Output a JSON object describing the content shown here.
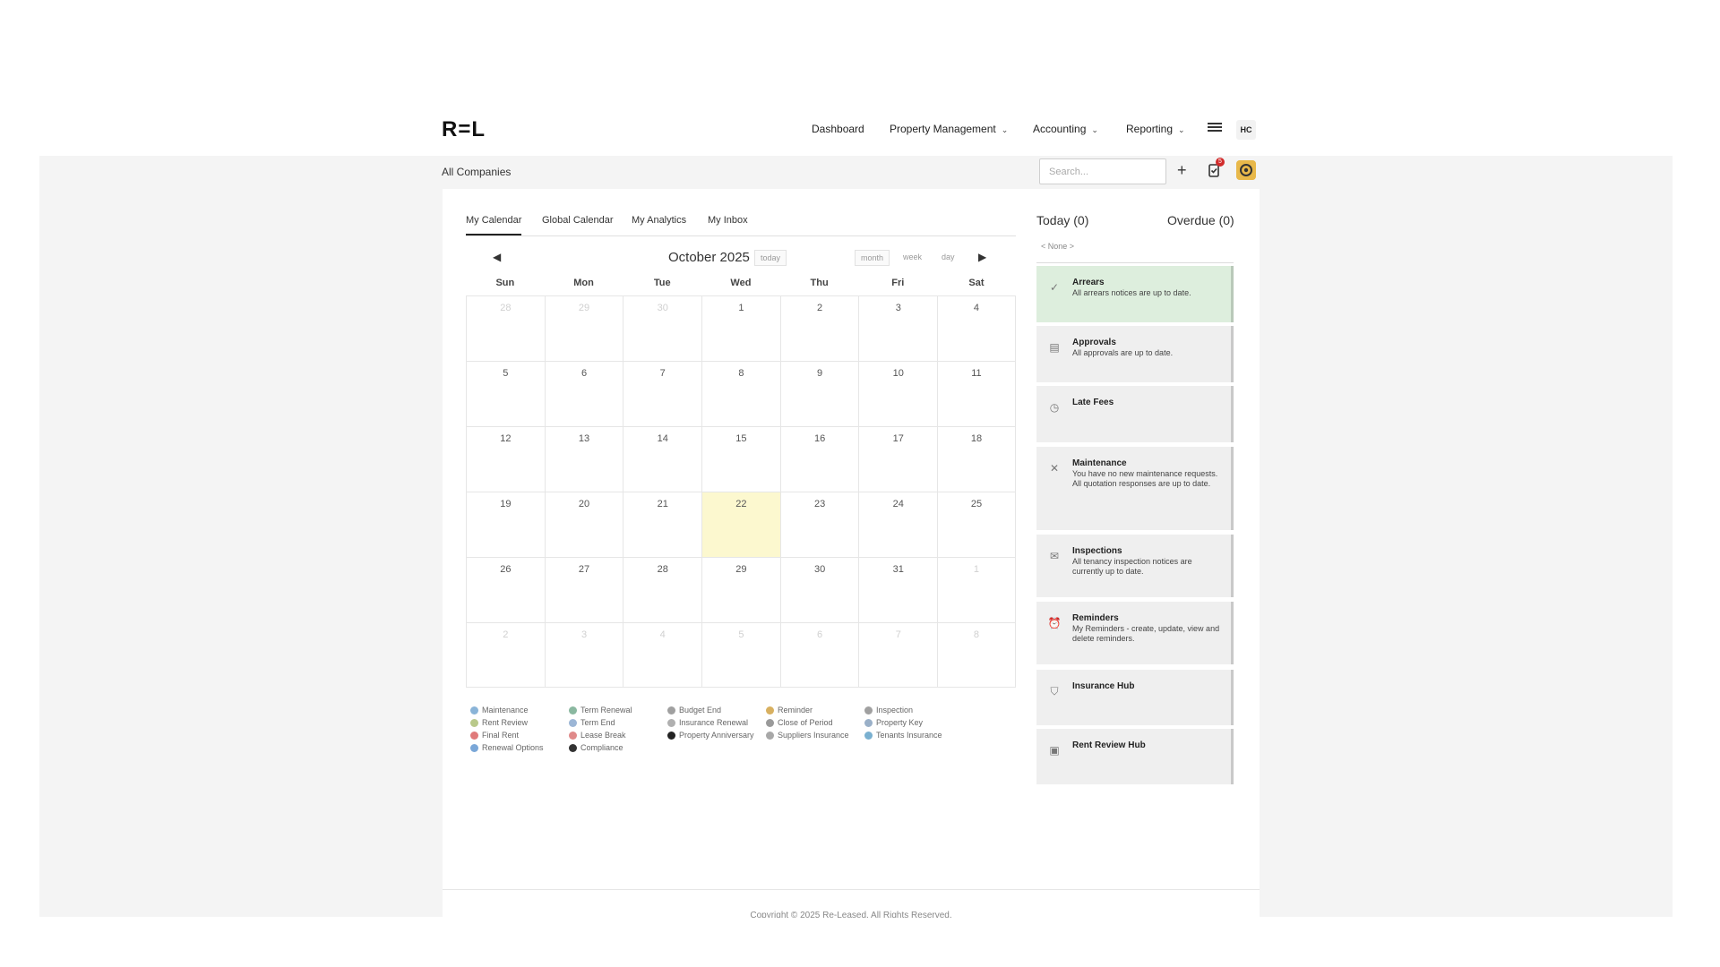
{
  "brand": {
    "logo_text": "R=L"
  },
  "nav": {
    "items": [
      {
        "label": "Dashboard",
        "has_dropdown": false
      },
      {
        "label": "Property Management",
        "has_dropdown": true
      },
      {
        "label": "Accounting",
        "has_dropdown": true
      },
      {
        "label": "Reporting",
        "has_dropdown": true
      }
    ],
    "user_initials": "HC"
  },
  "subbar": {
    "company": "All Companies",
    "search_placeholder": "Search...",
    "notification_count": "5"
  },
  "tabs": [
    {
      "label": "My Calendar",
      "active": true
    },
    {
      "label": "Global Calendar",
      "active": false
    },
    {
      "label": "My Analytics",
      "active": false
    },
    {
      "label": "My Inbox",
      "active": false
    }
  ],
  "calendar": {
    "title": "October 2025",
    "today_button": "today",
    "views": {
      "month": "month",
      "week": "week",
      "day": "day"
    },
    "weekdays": [
      "Sun",
      "Mon",
      "Tue",
      "Wed",
      "Thu",
      "Fri",
      "Sat"
    ],
    "weeks": [
      [
        {
          "d": "28",
          "o": true
        },
        {
          "d": "29",
          "o": true
        },
        {
          "d": "30",
          "o": true
        },
        {
          "d": "1"
        },
        {
          "d": "2"
        },
        {
          "d": "3"
        },
        {
          "d": "4"
        }
      ],
      [
        {
          "d": "5"
        },
        {
          "d": "6"
        },
        {
          "d": "7"
        },
        {
          "d": "8"
        },
        {
          "d": "9"
        },
        {
          "d": "10"
        },
        {
          "d": "11"
        }
      ],
      [
        {
          "d": "12"
        },
        {
          "d": "13"
        },
        {
          "d": "14"
        },
        {
          "d": "15"
        },
        {
          "d": "16"
        },
        {
          "d": "17"
        },
        {
          "d": "18"
        }
      ],
      [
        {
          "d": "19"
        },
        {
          "d": "20"
        },
        {
          "d": "21"
        },
        {
          "d": "22",
          "t": true
        },
        {
          "d": "23"
        },
        {
          "d": "24"
        },
        {
          "d": "25"
        }
      ],
      [
        {
          "d": "26"
        },
        {
          "d": "27"
        },
        {
          "d": "28"
        },
        {
          "d": "29"
        },
        {
          "d": "30"
        },
        {
          "d": "31"
        },
        {
          "d": "1",
          "o": true
        }
      ],
      [
        {
          "d": "2",
          "o": true
        },
        {
          "d": "3",
          "o": true
        },
        {
          "d": "4",
          "o": true
        },
        {
          "d": "5",
          "o": true
        },
        {
          "d": "6",
          "o": true
        },
        {
          "d": "7",
          "o": true
        },
        {
          "d": "8",
          "o": true
        }
      ]
    ]
  },
  "legend": [
    [
      {
        "label": "Maintenance",
        "color": "#8ab4d8"
      },
      {
        "label": "Rent Review",
        "color": "#b9c98a"
      },
      {
        "label": "Final Rent",
        "color": "#e07a7a"
      },
      {
        "label": "Renewal Options",
        "color": "#7aa7d8"
      }
    ],
    [
      {
        "label": "Term Renewal",
        "color": "#8ab8a0"
      },
      {
        "label": "Term End",
        "color": "#9cb6d6"
      },
      {
        "label": "Lease Break",
        "color": "#e08a8a"
      },
      {
        "label": "Compliance",
        "color": "#333333"
      }
    ],
    [
      {
        "label": "Budget End",
        "color": "#a0a0a0"
      },
      {
        "label": "Insurance Renewal",
        "color": "#b0b0b0"
      },
      {
        "label": "Property Anniversary",
        "color": "#222222"
      }
    ],
    [
      {
        "label": "Reminder",
        "color": "#d8b060"
      },
      {
        "label": "Close of Period",
        "color": "#9a9a9a"
      },
      {
        "label": "Suppliers Insurance",
        "color": "#a8a8a8"
      }
    ],
    [
      {
        "label": "Inspection",
        "color": "#a0a0a0"
      },
      {
        "label": "Property Key",
        "color": "#9ab0c8"
      },
      {
        "label": "Tenants Insurance",
        "color": "#7ab0d0"
      }
    ]
  ],
  "sidepanel": {
    "today_label": "Today (0)",
    "overdue_label": "Overdue (0)",
    "none_label": "< None >",
    "cards": [
      {
        "title": "Arrears",
        "desc": "All arrears notices are up to date.",
        "icon": "check-circle-icon",
        "glyph": "✓"
      },
      {
        "title": "Approvals",
        "desc": "All approvals are up to date.",
        "icon": "document-icon",
        "glyph": "▤"
      },
      {
        "title": "Late Fees",
        "desc": "",
        "icon": "clock-icon",
        "glyph": "◷"
      },
      {
        "title": "Maintenance",
        "desc": "You have no new maintenance requests.\nAll quotation responses are up to date.",
        "icon": "tools-icon",
        "glyph": "✕"
      },
      {
        "title": "Inspections",
        "desc": "All tenancy inspection notices are currently up to date.",
        "icon": "envelope-icon",
        "glyph": "✉"
      },
      {
        "title": "Reminders",
        "desc": "My Reminders - create, update, view and delete reminders.",
        "icon": "alarm-clock-icon",
        "glyph": "⏰"
      },
      {
        "title": "Insurance Hub",
        "desc": "",
        "icon": "shield-icon",
        "glyph": "⛉"
      },
      {
        "title": "Rent Review Hub",
        "desc": "",
        "icon": "id-card-icon",
        "glyph": "▣"
      }
    ]
  },
  "footer": {
    "copyright": "Copyright © 2025 Re-Leased. All Rights Reserved."
  }
}
